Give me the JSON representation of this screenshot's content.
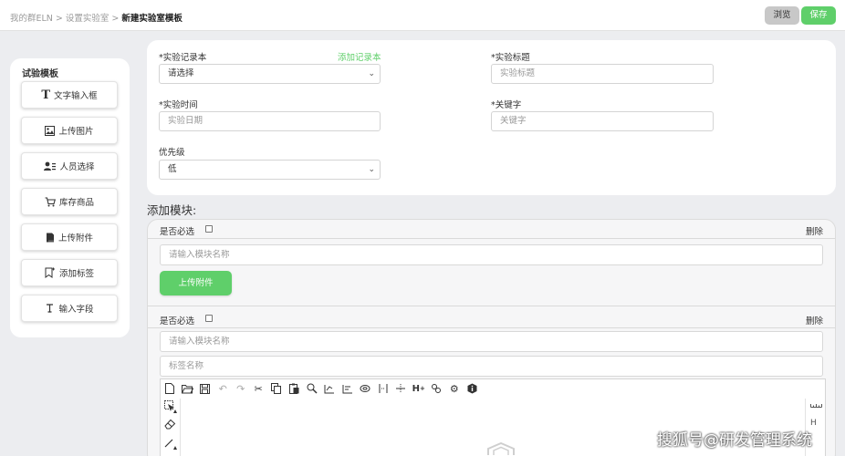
{
  "breadcrumb": {
    "items": [
      "我的群ELN",
      "设置实验室"
    ],
    "separator": ">",
    "current": "新建实验室模板"
  },
  "header_actions": {
    "preview_label": "浏览",
    "save_label": "保存"
  },
  "sidebar": {
    "title": "试验模板",
    "items": [
      {
        "label": "文字输入框",
        "icon": "text-icon",
        "glyph": "T"
      },
      {
        "label": "上传图片",
        "icon": "image-icon",
        "glyph": "▣"
      },
      {
        "label": "人员选择",
        "icon": "user-list-icon",
        "glyph": "👤"
      },
      {
        "label": "库存商品",
        "icon": "cart-icon",
        "glyph": "🛒"
      },
      {
        "label": "上传附件",
        "icon": "attachment-icon",
        "glyph": "▤"
      },
      {
        "label": "添加标签",
        "icon": "tag-icon",
        "glyph": "◫"
      },
      {
        "label": "输入字段",
        "icon": "field-icon",
        "glyph": "I"
      }
    ]
  },
  "form": {
    "notebook_label": "*实验记录本",
    "add_notebook_link": "添加记录本",
    "notebook_value": "请选择",
    "title_label": "*实验标题",
    "title_placeholder": "实验标题",
    "time_label": "*实验时间",
    "time_placeholder": "实验日期",
    "keyword_label": "*关键字",
    "keyword_placeholder": "关键字",
    "priority_label": "优先级",
    "priority_value": "低"
  },
  "modules": {
    "heading": "添加模块:",
    "required_label": "是否必选",
    "delete_label": "删除",
    "name_placeholder": "请输入模块名称",
    "upload_button": "上传附件",
    "tag_placeholder": "标签名称"
  },
  "editor": {
    "toolbar_icons": [
      "new-file-icon",
      "open-folder-icon",
      "save-icon",
      "undo-icon",
      "redo-icon",
      "cut-icon",
      "copy-icon",
      "paste-icon",
      "zoom-icon",
      "align-left-icon",
      "align-center-icon",
      "ring-icon",
      "spacing-icon",
      "distribute-icon",
      "h-plus-icon",
      "chain-icon",
      "settings-icon",
      "info-icon"
    ],
    "right_label": "H"
  },
  "watermark": "搜狐号@研发管理系统",
  "colors": {
    "accent_green": "#5fcf6a",
    "background": "#ecedf0",
    "panel": "#ffffff",
    "preview_button": "#c8c8c8"
  }
}
